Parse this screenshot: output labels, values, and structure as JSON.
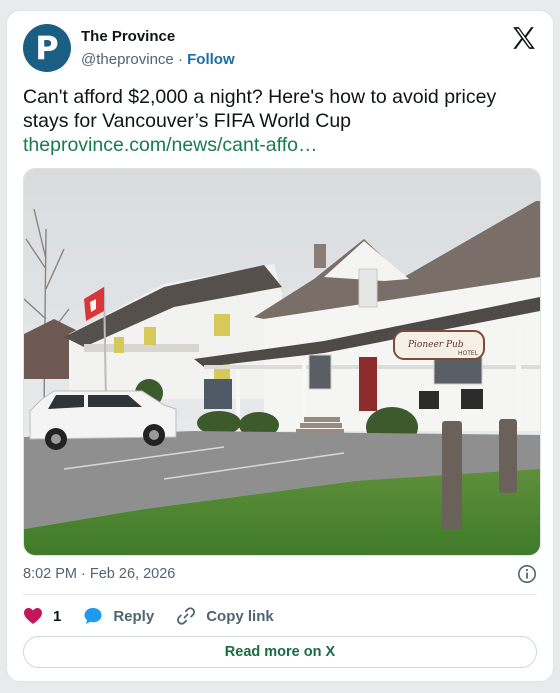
{
  "author": {
    "avatar_letter": "P",
    "display_name": "The Province",
    "handle": "@theprovince",
    "separator": "·",
    "follow_label": "Follow"
  },
  "tweet": {
    "text": "Can't afford $2,000 a night? Here's how to avoid pricey stays for Vancouver’s FIFA World Cup",
    "link": "theprovince.com/news/cant-affo…",
    "timestamp": "8:02 PM · Feb 26, 2026"
  },
  "media": {
    "description_icon": "photo",
    "sign_text": "Pioneer Pub",
    "sign_sub": "HOTEL"
  },
  "actions": {
    "like_count": "1",
    "reply_label": "Reply",
    "copy_label": "Copy link"
  },
  "footer": {
    "read_more_label": "Read more on X"
  },
  "colors": {
    "avatar": "#1a5f83",
    "link": "#1a7a50",
    "heart": "#f91880",
    "reply_bubble": "#1d9bf0"
  }
}
